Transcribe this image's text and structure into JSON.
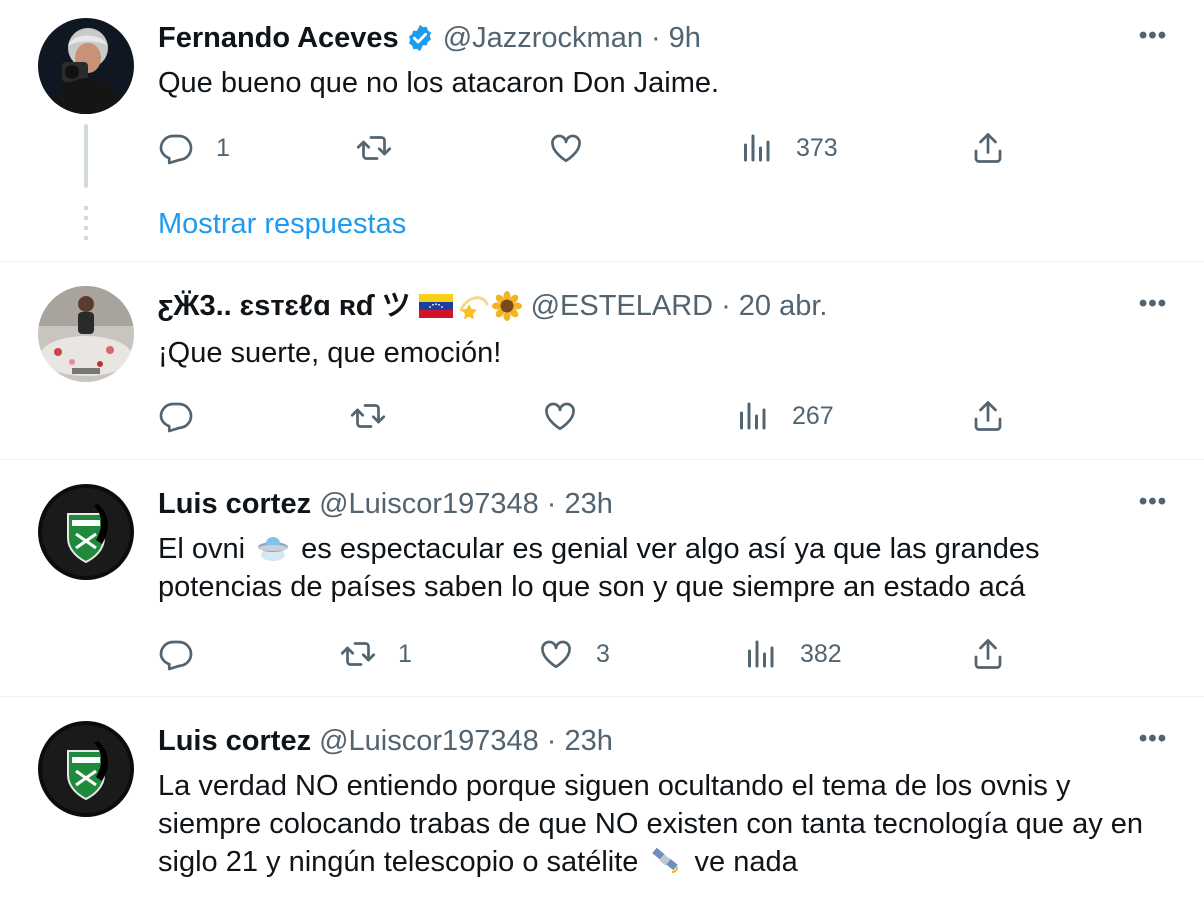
{
  "tweets": [
    {
      "name": "Fernando Aceves",
      "verified": true,
      "handle": "@Jazzrockman",
      "separator": "·",
      "time": "9h",
      "text": "Que bueno que no los atacaron Don Jaime.",
      "replies": "1",
      "retweets": "",
      "likes": "",
      "views": "373",
      "show_replies_label": "Mostrar respuestas",
      "more_label": "•••"
    },
    {
      "name": "ƹӜ3.. ɛsтɛℓɑ ʀɗ ツ",
      "name_emojis": [
        "venezuela-flag",
        "dizzy-star",
        "sunflower"
      ],
      "handle": "@ESTELARD",
      "separator": "·",
      "time": "20 abr.",
      "text": "¡Que suerte, que emoción!",
      "replies": "",
      "retweets": "",
      "likes": "",
      "views": "267",
      "more_label": "•••"
    },
    {
      "name": "Luis cortez",
      "handle": "@Luiscor197348",
      "separator": "·",
      "time": "23h",
      "text_before": "El ovni ",
      "text_after": " es espectacular es genial ver algo así ya que las grandes potencias de países saben lo que son y que siempre an estado acá",
      "replies": "",
      "retweets": "1",
      "likes": "3",
      "views": "382",
      "more_label": "•••"
    },
    {
      "name": "Luis cortez",
      "handle": "@Luiscor197348",
      "separator": "·",
      "time": "23h",
      "text_before": "La verdad NO entiendo porque siguen ocultando el tema de los ovnis y siempre colocando trabas de que NO existen con tanta tecnología que ay en siglo 21 y ningún telescopio o satélite ",
      "text_after": " ve nada",
      "more_label": "•••"
    }
  ],
  "colors": {
    "text": "#0f1419",
    "secondary": "#536471",
    "link": "#1d9bf0",
    "verified": "#1d9bf0",
    "divider": "#eff3f4"
  }
}
